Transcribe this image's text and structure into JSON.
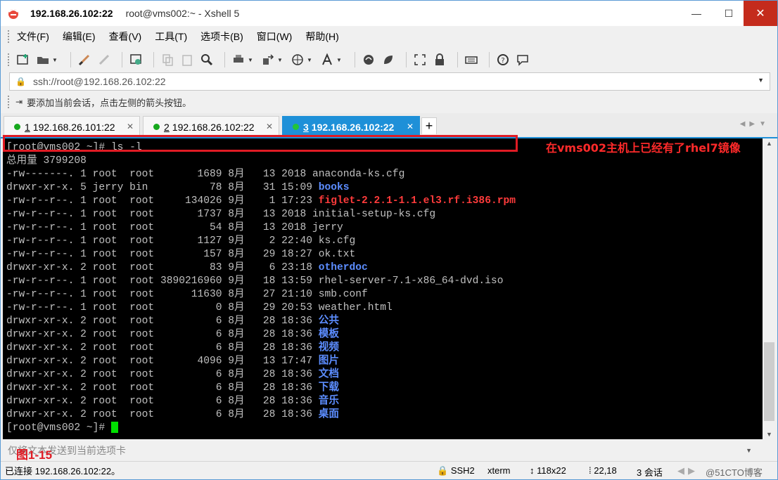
{
  "window": {
    "title_host": "192.168.26.102:22",
    "title_rest": "root@vms002:~ - Xshell 5",
    "min": "—",
    "max": "☐",
    "close": "✕"
  },
  "menu": [
    "文件(F)",
    "编辑(E)",
    "查看(V)",
    "工具(T)",
    "选项卡(B)",
    "窗口(W)",
    "帮助(H)"
  ],
  "address": {
    "value": "ssh://root@192.168.26.102:22"
  },
  "hint": "要添加当前会话，点击左侧的箭头按钮。",
  "tabs": [
    {
      "num": "1",
      "label": "192.168.26.101:22"
    },
    {
      "num": "2",
      "label": "192.168.26.102:22"
    },
    {
      "num": "3",
      "label": "192.168.26.102:22"
    }
  ],
  "tab_add": "+",
  "terminal": {
    "lines": [
      [
        {
          "t": "[root@vms002 ~]# ls -l"
        }
      ],
      [
        {
          "t": "总用量 3799208"
        }
      ],
      [
        {
          "t": "-rw-------. 1 root  root       1689 8月   13 2018 anaconda-ks.cfg"
        }
      ],
      [
        {
          "t": "drwxr-xr-x. 5 jerry bin          78 8月   31 15:09 "
        },
        {
          "t": "books",
          "c": "dir"
        }
      ],
      [
        {
          "t": "-rw-r--r--. 1 root  root     134026 9月    1 17:23 "
        },
        {
          "t": "figlet-2.2.1-1.1.el3.rf.i386.rpm",
          "c": "rpm"
        }
      ],
      [
        {
          "t": "-rw-r--r--. 1 root  root       1737 8月   13 2018 initial-setup-ks.cfg"
        }
      ],
      [
        {
          "t": "-rw-r--r--. 1 root  root         54 8月   13 2018 jerry"
        }
      ],
      [
        {
          "t": "-rw-r--r--. 1 root  root       1127 9月    2 22:40 ks.cfg"
        }
      ],
      [
        {
          "t": "-rw-r--r--. 1 root  root        157 8月   29 18:27 ok.txt"
        }
      ],
      [
        {
          "t": "drwxr-xr-x. 2 root  root         83 9月    6 23:18 "
        },
        {
          "t": "otherdoc",
          "c": "dir"
        }
      ],
      [
        {
          "t": "-rw-r--r--. 1 root  root 3890216960 9月   18 13:59 rhel-server-7.1-x86_64-dvd.iso"
        }
      ],
      [
        {
          "t": "-rw-r--r--. 1 root  root      11630 8月   27 21:10 smb.conf"
        }
      ],
      [
        {
          "t": "-rw-r--r--. 1 root  root          0 8月   29 20:53 weather.html"
        }
      ],
      [
        {
          "t": "drwxr-xr-x. 2 root  root          6 8月   28 18:36 "
        },
        {
          "t": "公共",
          "c": "dir"
        }
      ],
      [
        {
          "t": "drwxr-xr-x. 2 root  root          6 8月   28 18:36 "
        },
        {
          "t": "模板",
          "c": "dir"
        }
      ],
      [
        {
          "t": "drwxr-xr-x. 2 root  root          6 8月   28 18:36 "
        },
        {
          "t": "视频",
          "c": "dir"
        }
      ],
      [
        {
          "t": "drwxr-xr-x. 2 root  root       4096 9月   13 17:47 "
        },
        {
          "t": "图片",
          "c": "dir"
        }
      ],
      [
        {
          "t": "drwxr-xr-x. 2 root  root          6 8月   28 18:36 "
        },
        {
          "t": "文档",
          "c": "dir"
        }
      ],
      [
        {
          "t": "drwxr-xr-x. 2 root  root          6 8月   28 18:36 "
        },
        {
          "t": "下载",
          "c": "dir"
        }
      ],
      [
        {
          "t": "drwxr-xr-x. 2 root  root          6 8月   28 18:36 "
        },
        {
          "t": "音乐",
          "c": "dir"
        }
      ],
      [
        {
          "t": "drwxr-xr-x. 2 root  root          6 8月   28 18:36 "
        },
        {
          "t": "桌面",
          "c": "dir"
        }
      ],
      [
        {
          "t": "[root@vms002 ~]# "
        },
        {
          "t": "",
          "c": "cursor"
        }
      ]
    ],
    "annotation": "在vms002主机上已经有了rhel7镜像"
  },
  "input_bar": {
    "placeholder": "仅将文本发送到当前选项卡",
    "figure_label": "图1-15"
  },
  "status": {
    "connection": "已连接 192.168.26.102:22。",
    "protocol": "SSH2",
    "term": "xterm",
    "size": "118x22",
    "position": "22,18",
    "sessions": "3 会话",
    "watermark": "@51CTO博客"
  },
  "colors": {
    "accent": "#1e90d8",
    "highlight": "#e01b24",
    "dir": "#5c8dff",
    "rpm": "#ff3b3b",
    "cursor": "#00e000"
  }
}
